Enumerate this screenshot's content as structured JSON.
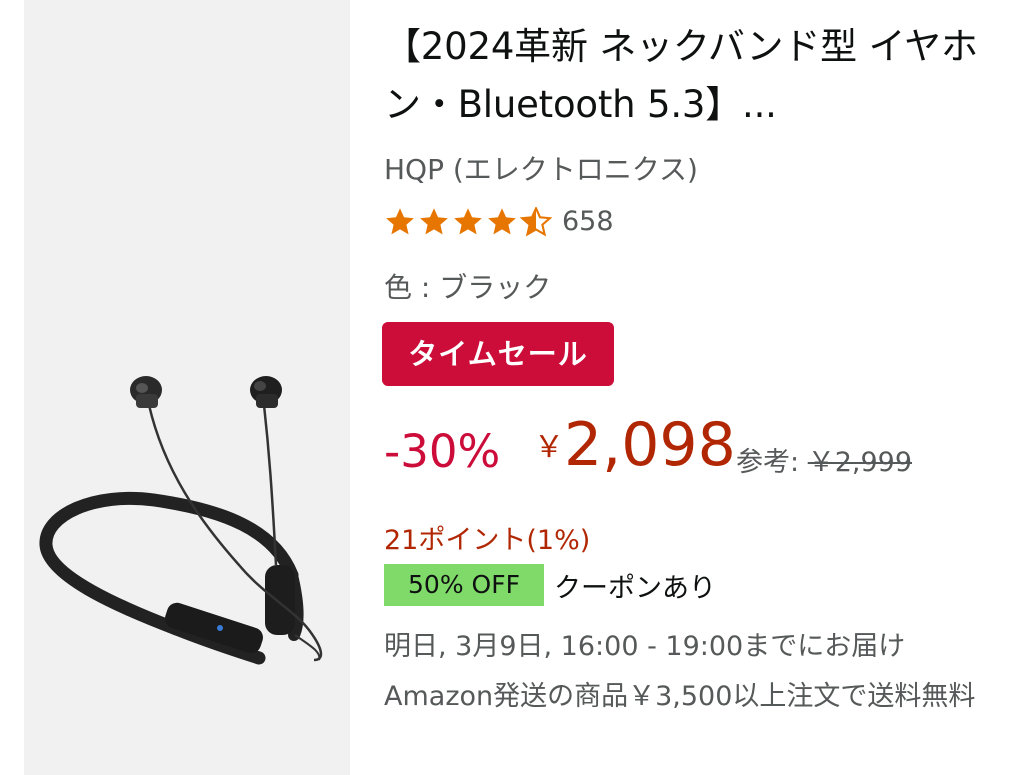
{
  "product": {
    "title": "【2024革新 ネックバンド型 イヤホン・Bluetooth 5.3】...",
    "brand": "HQP (エレクトロニクス)",
    "rating": {
      "value": 4.5,
      "count": "658",
      "star_color": "#e77600"
    },
    "color_label": "色 : ブラック",
    "badge": {
      "label": "タイムセール",
      "color": "#cc0c39"
    },
    "price": {
      "discount": "-30%",
      "currency": "￥",
      "amount": "2,098",
      "reference_label": "参考:",
      "reference_price": "￥2,999",
      "price_color": "#b12704"
    },
    "points": "21ポイント(1%)",
    "coupon": {
      "badge": "50% OFF",
      "text": "クーポンあり",
      "badge_color": "#7fda69"
    },
    "delivery": {
      "line1": "明日, 3月9日, 16:00 - 19:00までにお届け",
      "line2": "Amazon発送の商品￥3,500以上注文で送料無料"
    },
    "image_icon": "neckband-earphones-image"
  }
}
